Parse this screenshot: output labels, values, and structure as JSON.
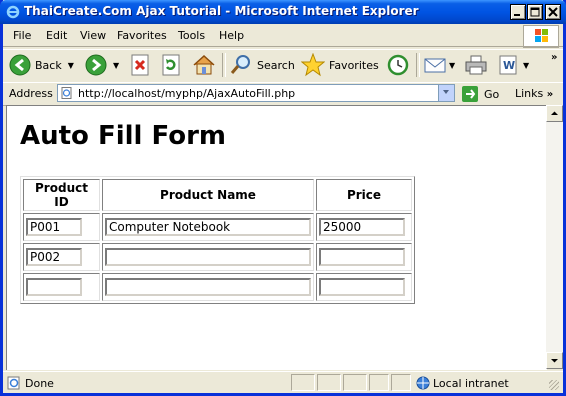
{
  "window": {
    "title": "ThaiCreate.Com Ajax Tutorial - Microsoft Internet Explorer"
  },
  "menu": [
    "File",
    "Edit",
    "View",
    "Favorites",
    "Tools",
    "Help"
  ],
  "toolbar": {
    "back": "Back",
    "search": "Search",
    "favorites": "Favorites"
  },
  "address": {
    "label": "Address",
    "url": "http://localhost/myphp/AjaxAutoFill.php",
    "go": "Go",
    "links": "Links"
  },
  "page": {
    "title": "Auto Fill Form",
    "columns": [
      "Product ID",
      "Product Name",
      "Price"
    ],
    "rows": [
      {
        "id": "P001",
        "name": "Computer Notebook",
        "price": "25000"
      },
      {
        "id": "P002",
        "name": "",
        "price": ""
      },
      {
        "id": "",
        "name": "",
        "price": ""
      }
    ]
  },
  "status": {
    "text": "Done",
    "zone": "Local intranet"
  }
}
